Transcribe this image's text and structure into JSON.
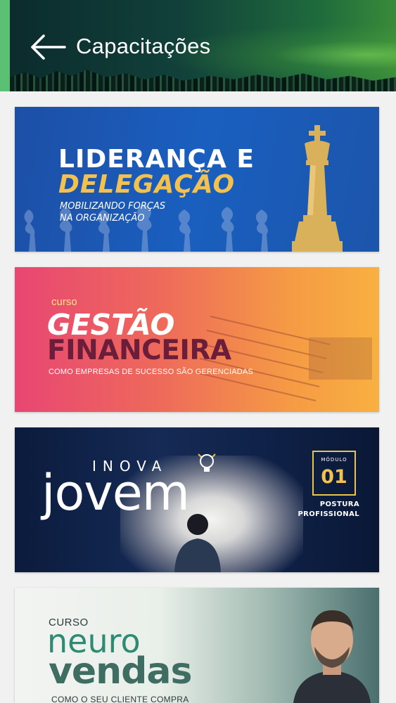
{
  "header": {
    "title": "Capacitações",
    "back_icon": "arrow-left-icon",
    "accent_color": "#5bbf74"
  },
  "courses": [
    {
      "title_line1": "LIDERANÇA E",
      "title_line2": "DELEGAÇÃO",
      "subtitle_line1": "MOBILIZANDO FORÇAS",
      "subtitle_line2": "NA ORGANIZAÇÃO",
      "colors": {
        "background": "#1d4fa6",
        "highlight": "#f2c14e"
      }
    },
    {
      "kicker": "curso",
      "title_line1": "GESTÃO",
      "title_line2": "FINANCEIRA",
      "subtitle": "COMO EMPRESAS DE SUCESSO SÃO GERENCIADAS",
      "colors": {
        "start": "#e84673",
        "end": "#f8b040",
        "title2": "#6b1d3a"
      }
    },
    {
      "title_line1": "INOVA",
      "title_line2": "jovem",
      "module_label": "MÓDULO",
      "module_number": "01",
      "module_title_line1": "POSTURA",
      "module_title_line2": "PROFISSIONAL",
      "colors": {
        "background": "#0b1b3d",
        "accent": "#f2c14e"
      }
    },
    {
      "kicker": "CURSO",
      "title_line1": "neuro",
      "title_line2": "vendas",
      "subtitle": "COMO O SEU CLIENTE COMPRA",
      "colors": {
        "neuro": "#2e8a73",
        "vendas": "#3f6d62"
      }
    }
  ]
}
